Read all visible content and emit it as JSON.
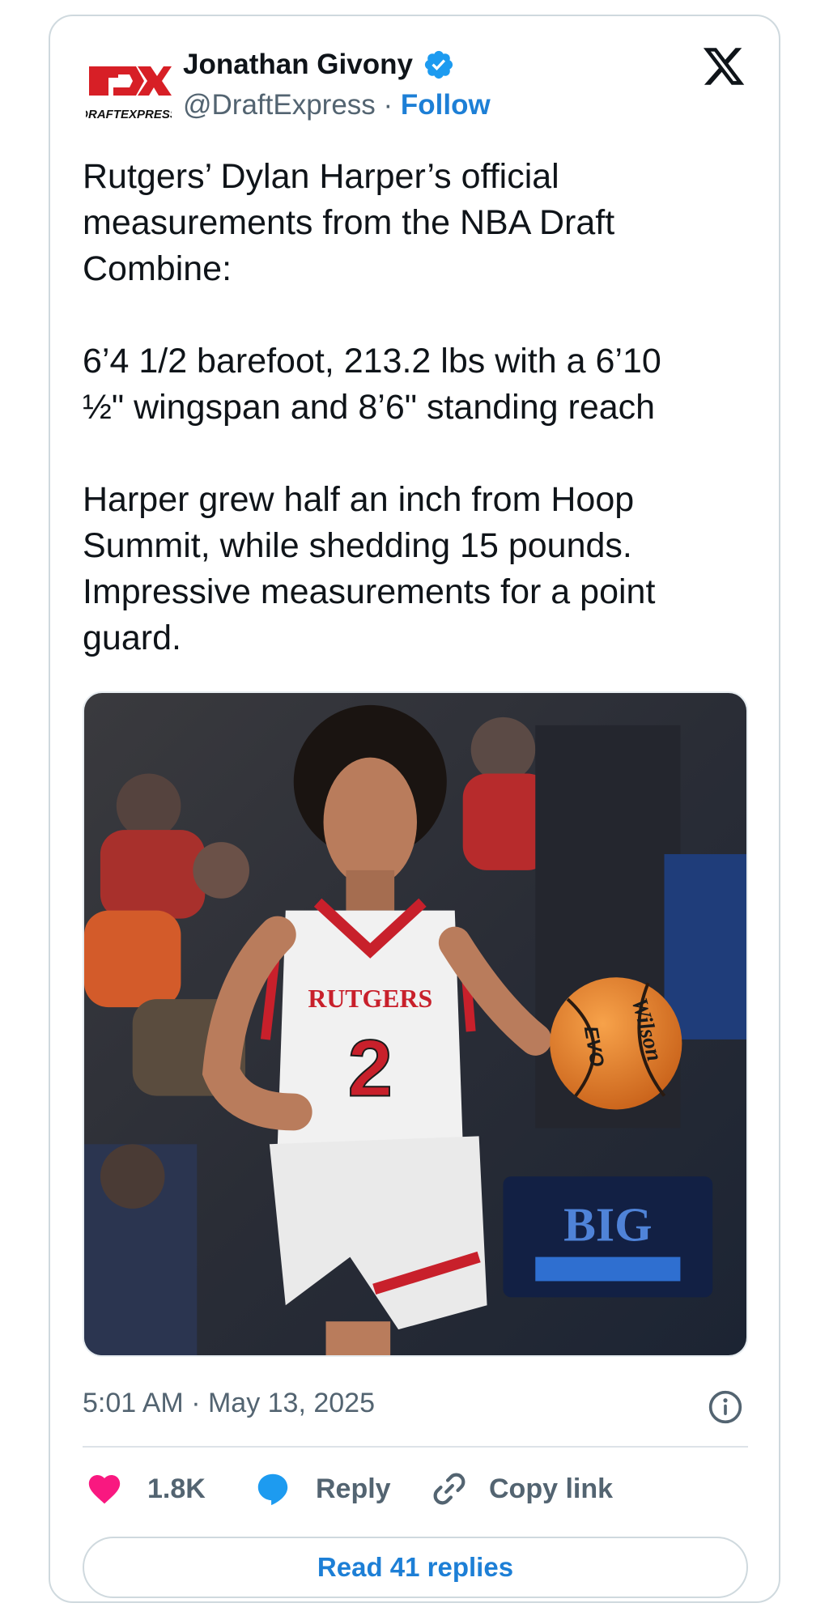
{
  "author": {
    "logo_text": "DRAFTEXPRESS",
    "name": "Jonathan Givony",
    "handle": "@DraftExpress",
    "separator": " · ",
    "follow_label": "Follow"
  },
  "tweet": {
    "text": "Rutgers’ Dylan Harper’s official\nmeasurements from the NBA Draft\nCombine:\n\n6’4 1/2 barefoot, 213.2 lbs with a 6’10\n½\" wingspan and 8’6\" standing reach\n\nHarper grew half an inch from Hoop\nSummit, while shedding 15 pounds.\nImpressive measurements for a point\nguard.",
    "timestamp": "5:01 AM · May 13, 2025"
  },
  "media": {
    "jersey_text": "RUTGERS",
    "jersey_number": "2",
    "ball_text": "Wilson",
    "ball_model": "EVO",
    "conference_text": "BIG"
  },
  "actions": {
    "like_count": "1.8K",
    "reply_label": "Reply",
    "copy_label": "Copy link"
  },
  "footer": {
    "read_replies_label": "Read 41 replies"
  },
  "colors": {
    "link_blue": "#1d7fd6",
    "heart_pink": "#f91880",
    "verified_blue": "#1d9bf0",
    "brand_red": "#d71f26"
  }
}
